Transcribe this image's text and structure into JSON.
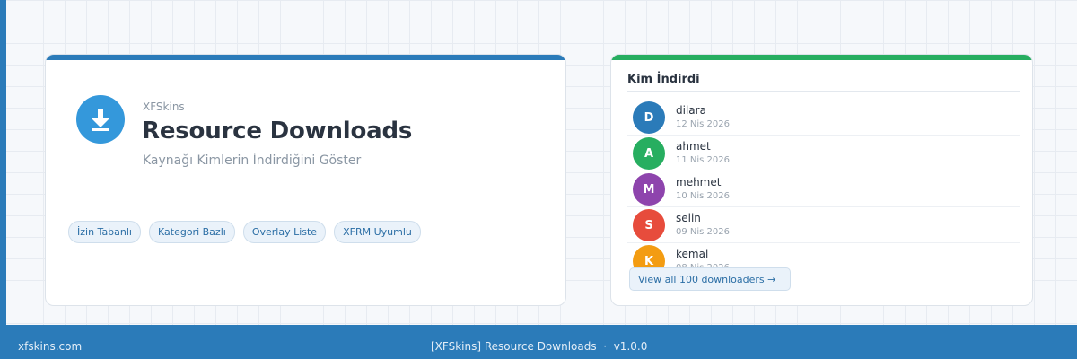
{
  "hero": {
    "brand": "XFSkins",
    "title": "Resource Downloads",
    "subtitle": "Kaynağı Kimlerin İndirdiğini Göster",
    "icon": "download-icon",
    "tags": [
      "İzin Tabanlı",
      "Kategori Bazlı",
      "Overlay Liste",
      "XFRM Uyumlu"
    ]
  },
  "downloaders": {
    "title": "Kim İndirdi",
    "users": [
      {
        "initial": "D",
        "name": "dilara",
        "date": "12 Nis 2026",
        "color": "#2b7bb9"
      },
      {
        "initial": "A",
        "name": "ahmet",
        "date": "11 Nis 2026",
        "color": "#27ae60"
      },
      {
        "initial": "M",
        "name": "mehmet",
        "date": "10 Nis 2026",
        "color": "#8e44ad"
      },
      {
        "initial": "S",
        "name": "selin",
        "date": "09 Nis 2026",
        "color": "#e74c3c"
      },
      {
        "initial": "K",
        "name": "kemal",
        "date": "08 Nis 2026",
        "color": "#f39c12"
      }
    ],
    "view_all": "View all 100 downloaders →"
  },
  "footer": {
    "site": "xfskins.com",
    "product": "[XFSkins] Resource Downloads",
    "separator": "·",
    "version": "v1.0.0"
  },
  "colors": {
    "primary": "#2b7bb9",
    "success": "#27ae60"
  }
}
